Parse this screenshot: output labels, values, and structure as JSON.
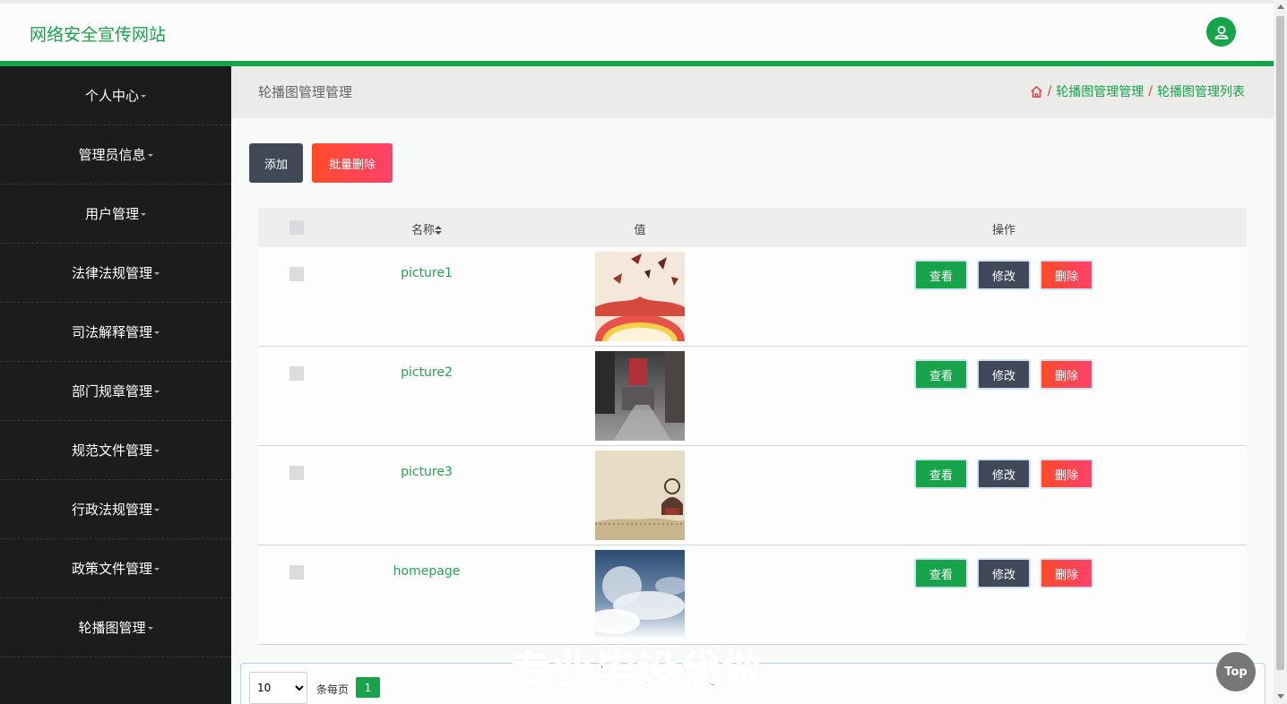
{
  "header": {
    "site_title": "网络安全宣传网站",
    "avatar_icon": "user-icon"
  },
  "sidebar": {
    "items": [
      {
        "label": "个人中心"
      },
      {
        "label": "管理员信息"
      },
      {
        "label": "用户管理"
      },
      {
        "label": "法律法规管理"
      },
      {
        "label": "司法解释管理"
      },
      {
        "label": "部门规章管理"
      },
      {
        "label": "规范文件管理"
      },
      {
        "label": "行政法规管理"
      },
      {
        "label": "政策文件管理"
      },
      {
        "label": "轮播图管理"
      }
    ]
  },
  "breadcrumb": {
    "title": "轮播图管理管理",
    "home_icon": "home-icon",
    "level1": "轮播图管理管理",
    "level2": "轮播图管理列表",
    "separator": "/"
  },
  "toolbar": {
    "add_label": "添加",
    "batch_delete_label": "批量删除"
  },
  "table": {
    "headers": {
      "name": "名称",
      "value": "值",
      "actions": "操作"
    },
    "sort_icon": "sort-icon",
    "rows": [
      {
        "name": "picture1",
        "image": "festive-banner-thumbnail"
      },
      {
        "name": "picture2",
        "image": "street-photo-thumbnail"
      },
      {
        "name": "picture3",
        "image": "ink-landscape-thumbnail"
      },
      {
        "name": "homepage",
        "image": "cloudy-sky-thumbnail"
      }
    ],
    "actions": {
      "view": "查看",
      "edit": "修改",
      "delete": "删除"
    }
  },
  "pagination": {
    "page_size": "10",
    "page_size_options": [
      "10"
    ],
    "per_page_label": "条每页",
    "current_page": "1"
  },
  "watermark": "专业毕设代做",
  "back_to_top": "Top",
  "colors": {
    "brand_green": "#17a349",
    "dark": "#414857",
    "danger": "#ff416c",
    "sidebar_bg": "#1b1d1c"
  }
}
